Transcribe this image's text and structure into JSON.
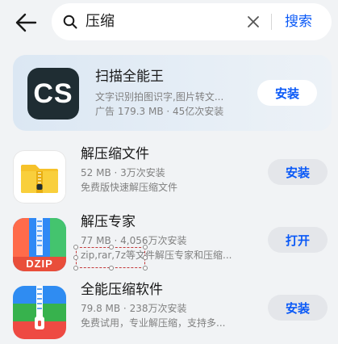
{
  "search": {
    "query": "压缩",
    "submit_label": "搜索"
  },
  "icons": {
    "back": "arrow-left-icon",
    "search": "search-icon",
    "clear": "close-icon"
  },
  "colors": {
    "accent": "#0a59f7",
    "background": "#f1f3f5"
  },
  "ad_card": {
    "icon_text": "CS",
    "title": "扫描全能王",
    "description": "文字识别拍图识字,图片转文...",
    "meta": "广告 179.3 MB · 45亿次安装",
    "button": "安装"
  },
  "apps": [
    {
      "title": "解压缩文件",
      "meta": "52 MB · 3万次安装",
      "description": "免费版快速解压缩文件",
      "button": "安装"
    },
    {
      "icon_text": "DZIP",
      "title": "解压专家",
      "meta": "77 MB · 4,056万次安装",
      "description": "zip,rar,7z等文件解压专家和压缩...",
      "button": "打开"
    },
    {
      "title": "全能压缩软件",
      "meta": "79.8 MB · 238万次安装",
      "description": "免费试用，专业解压缩，支持多...",
      "button": "安装"
    }
  ]
}
